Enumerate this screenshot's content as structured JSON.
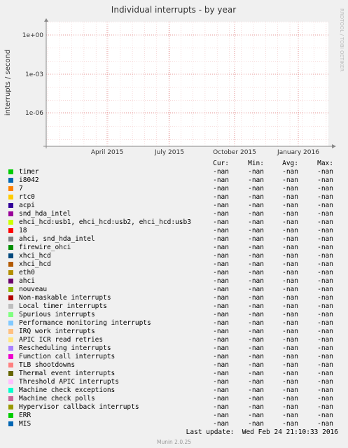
{
  "chart_data": {
    "type": "line",
    "title": "Individual interrupts - by year",
    "ylabel": "interrupts / second",
    "side_label": "RRDTOOL / TOBI OETIKER",
    "yscale": "log",
    "yticks": [
      "1e+00",
      "1e-03",
      "1e-06"
    ],
    "xticks": [
      "April 2015",
      "July 2015",
      "October 2015",
      "January 2016"
    ],
    "grid": true,
    "series": [
      {
        "name": "timer",
        "color": "#00cc00",
        "cur": "-nan",
        "min": "-nan",
        "avg": "-nan",
        "max": "-nan"
      },
      {
        "name": "i8042",
        "color": "#0066b3",
        "cur": "-nan",
        "min": "-nan",
        "avg": "-nan",
        "max": "-nan"
      },
      {
        "name": "7",
        "color": "#ff8000",
        "cur": "-nan",
        "min": "-nan",
        "avg": "-nan",
        "max": "-nan"
      },
      {
        "name": "rtc0",
        "color": "#ffcc00",
        "cur": "-nan",
        "min": "-nan",
        "avg": "-nan",
        "max": "-nan"
      },
      {
        "name": "acpi",
        "color": "#330099",
        "cur": "-nan",
        "min": "-nan",
        "avg": "-nan",
        "max": "-nan"
      },
      {
        "name": "snd_hda_intel",
        "color": "#990099",
        "cur": "-nan",
        "min": "-nan",
        "avg": "-nan",
        "max": "-nan"
      },
      {
        "name": "ehci_hcd:usb1, ehci_hcd:usb2, ehci_hcd:usb3",
        "color": "#ccff00",
        "cur": "-nan",
        "min": "-nan",
        "avg": "-nan",
        "max": "-nan"
      },
      {
        "name": "18",
        "color": "#ff0000",
        "cur": "-nan",
        "min": "-nan",
        "avg": "-nan",
        "max": "-nan"
      },
      {
        "name": "ahci, snd_hda_intel",
        "color": "#808080",
        "cur": "-nan",
        "min": "-nan",
        "avg": "-nan",
        "max": "-nan"
      },
      {
        "name": "firewire_ohci",
        "color": "#008f00",
        "cur": "-nan",
        "min": "-nan",
        "avg": "-nan",
        "max": "-nan"
      },
      {
        "name": "xhci_hcd",
        "color": "#00487d",
        "cur": "-nan",
        "min": "-nan",
        "avg": "-nan",
        "max": "-nan"
      },
      {
        "name": "xhci_hcd",
        "color": "#b35a00",
        "cur": "-nan",
        "min": "-nan",
        "avg": "-nan",
        "max": "-nan"
      },
      {
        "name": "eth0",
        "color": "#b38f00",
        "cur": "-nan",
        "min": "-nan",
        "avg": "-nan",
        "max": "-nan"
      },
      {
        "name": "ahci",
        "color": "#6b006b",
        "cur": "-nan",
        "min": "-nan",
        "avg": "-nan",
        "max": "-nan"
      },
      {
        "name": "nouveau",
        "color": "#8fb300",
        "cur": "-nan",
        "min": "-nan",
        "avg": "-nan",
        "max": "-nan"
      },
      {
        "name": "Non-maskable interrupts",
        "color": "#b30000",
        "cur": "-nan",
        "min": "-nan",
        "avg": "-nan",
        "max": "-nan"
      },
      {
        "name": "Local timer interrupts",
        "color": "#bebebe",
        "cur": "-nan",
        "min": "-nan",
        "avg": "-nan",
        "max": "-nan"
      },
      {
        "name": "Spurious interrupts",
        "color": "#80ff80",
        "cur": "-nan",
        "min": "-nan",
        "avg": "-nan",
        "max": "-nan"
      },
      {
        "name": "Performance monitoring interrupts",
        "color": "#80c9ff",
        "cur": "-nan",
        "min": "-nan",
        "avg": "-nan",
        "max": "-nan"
      },
      {
        "name": "IRQ work interrupts",
        "color": "#ffc080",
        "cur": "-nan",
        "min": "-nan",
        "avg": "-nan",
        "max": "-nan"
      },
      {
        "name": "APIC ICR read retries",
        "color": "#ffe680",
        "cur": "-nan",
        "min": "-nan",
        "avg": "-nan",
        "max": "-nan"
      },
      {
        "name": "Rescheduling interrupts",
        "color": "#aa80ff",
        "cur": "-nan",
        "min": "-nan",
        "avg": "-nan",
        "max": "-nan"
      },
      {
        "name": "Function call interrupts",
        "color": "#ee00cc",
        "cur": "-nan",
        "min": "-nan",
        "avg": "-nan",
        "max": "-nan"
      },
      {
        "name": "TLB shootdowns",
        "color": "#ff8080",
        "cur": "-nan",
        "min": "-nan",
        "avg": "-nan",
        "max": "-nan"
      },
      {
        "name": "Thermal event interrupts",
        "color": "#666600",
        "cur": "-nan",
        "min": "-nan",
        "avg": "-nan",
        "max": "-nan"
      },
      {
        "name": "Threshold APIC interrupts",
        "color": "#ffbfff",
        "cur": "-nan",
        "min": "-nan",
        "avg": "-nan",
        "max": "-nan"
      },
      {
        "name": "Machine check exceptions",
        "color": "#00ffcc",
        "cur": "-nan",
        "min": "-nan",
        "avg": "-nan",
        "max": "-nan"
      },
      {
        "name": "Machine check polls",
        "color": "#cc6699",
        "cur": "-nan",
        "min": "-nan",
        "avg": "-nan",
        "max": "-nan"
      },
      {
        "name": "Hypervisor callback interrupts",
        "color": "#999900",
        "cur": "-nan",
        "min": "-nan",
        "avg": "-nan",
        "max": "-nan"
      },
      {
        "name": "ERR",
        "color": "#00cc00",
        "cur": "-nan",
        "min": "-nan",
        "avg": "-nan",
        "max": "-nan"
      },
      {
        "name": "MIS",
        "color": "#0066b3",
        "cur": "-nan",
        "min": "-nan",
        "avg": "-nan",
        "max": "-nan"
      }
    ]
  },
  "legend_headers": {
    "cur": "Cur:",
    "min": "Min:",
    "avg": "Avg:",
    "max": "Max:"
  },
  "footer": {
    "last_update": "Last update:  Wed Feb 24 21:10:33 2016",
    "version": "Munin 2.0.25"
  }
}
